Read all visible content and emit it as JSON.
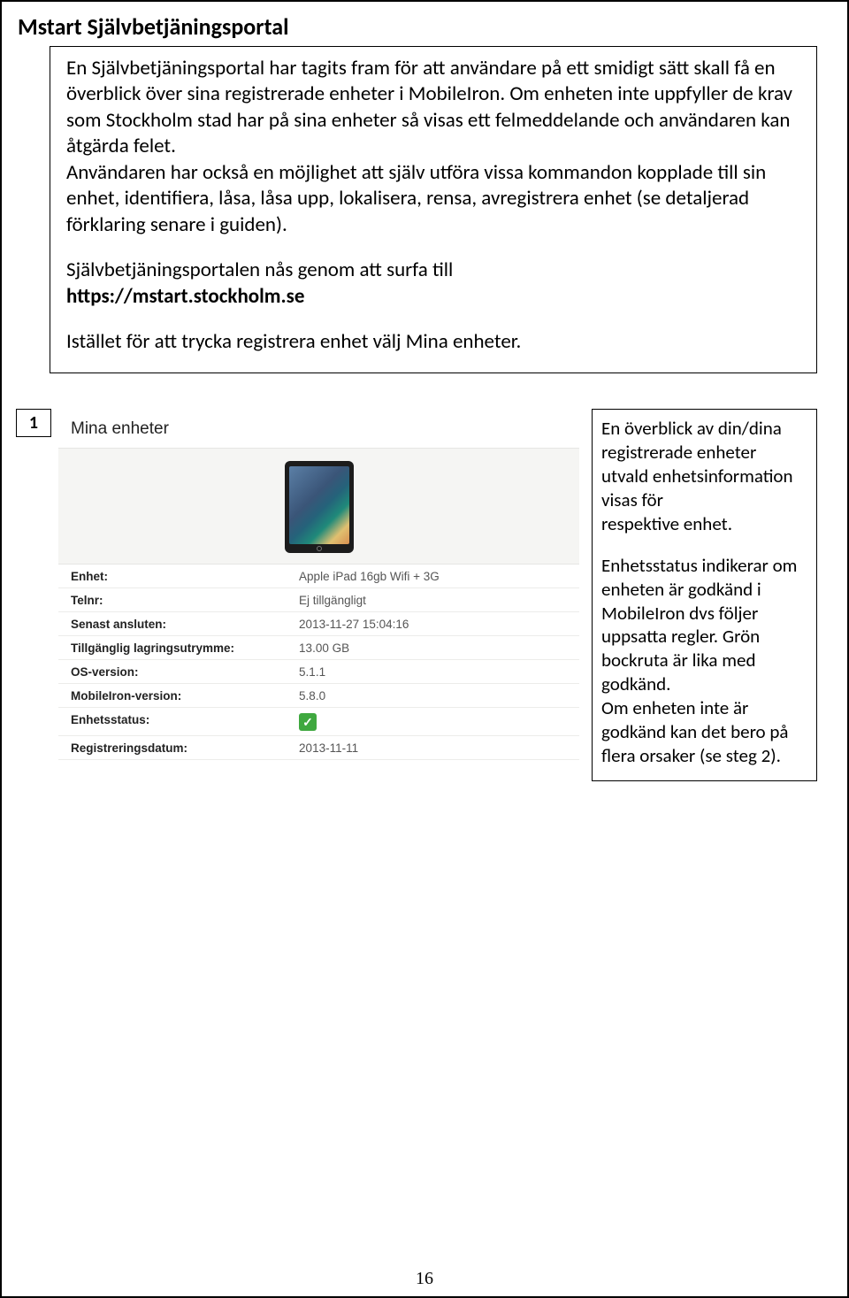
{
  "title": "Mstart Självbetjäningsportal",
  "intro": {
    "p1": "En Självbetjäningsportal har tagits fram för att användare på ett smidigt sätt skall få en överblick över sina registrerade enheter i MobileIron. Om enheten inte uppfyller de krav som Stockholm stad har på sina enheter så visas ett felmeddelande och användaren kan åtgärda felet.",
    "p2": "Användaren har också en möjlighet att själv utföra vissa kommandon kopplade till sin enhet, identifiera, låsa, låsa upp, lokalisera, rensa, avregistrera enhet (se detaljerad förklaring senare i guiden).",
    "p3": "Självbetjäningsportalen nås genom att surfa till",
    "url": "https://mstart.stockholm.se",
    "p4": "Istället för att trycka registrera enhet välj Mina enheter."
  },
  "step_number": "1",
  "screenshot": {
    "header": "Mina enheter",
    "rows": [
      {
        "label": "Enhet:",
        "value": "Apple iPad 16gb Wifi + 3G"
      },
      {
        "label": "Telnr:",
        "value": "Ej tillgängligt"
      },
      {
        "label": "Senast ansluten:",
        "value": "2013-11-27 15:04:16"
      },
      {
        "label": "Tillgänglig lagringsutrymme:",
        "value": "13.00 GB"
      },
      {
        "label": "OS-version:",
        "value": "5.1.1"
      },
      {
        "label": "MobileIron-version:",
        "value": "5.8.0"
      },
      {
        "label": "Enhetsstatus:",
        "value": "__CHECK__"
      },
      {
        "label": "Registreringsdatum:",
        "value": "2013-11-11"
      }
    ]
  },
  "desc": {
    "p1": "En överblick av din/dina registrerade enheter utvald enhetsinformation visas för",
    "p1b": "respektive enhet.",
    "p2": "Enhetsstatus indikerar om enheten är godkänd i",
    "p2b": "MobileIron dvs följer uppsatta regler. Grön bockruta  är lika med godkänd.",
    "p2c": "Om enheten inte är godkänd kan det bero på flera orsaker (se steg 2)."
  },
  "page_number": "16"
}
